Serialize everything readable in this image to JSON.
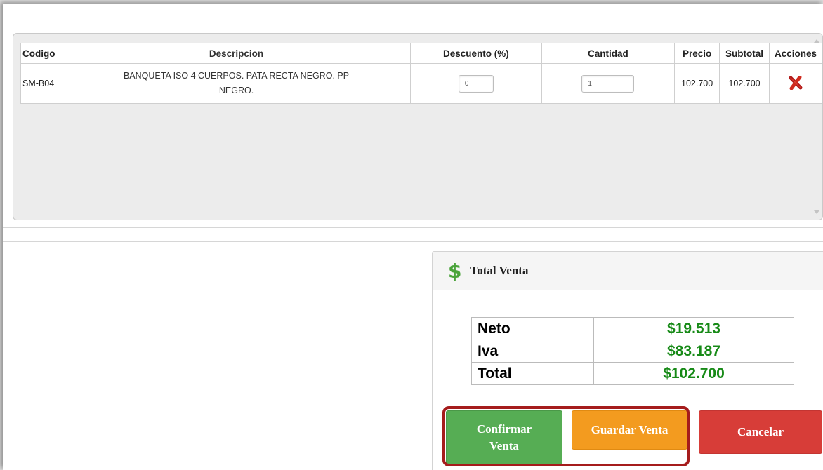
{
  "items_table": {
    "headers": [
      "Codigo",
      "Descripcion",
      "Descuento (%)",
      "Cantidad",
      "Precio",
      "Subtotal",
      "Acciones"
    ],
    "rows": [
      {
        "codigo": "SM-B04",
        "descripcion_line1": "BANQUETA ISO 4 CUERPOS. PATA RECTA NEGRO. PP",
        "descripcion_line2": "NEGRO.",
        "descuento": "0",
        "cantidad": "1",
        "precio": "102.700",
        "subtotal": "102.700",
        "accion_icon": "delete-x-icon"
      }
    ]
  },
  "total_venta": {
    "icon": "dollar-icon",
    "title": "Total Venta",
    "neto_label": "Neto",
    "neto_value": "$19.513",
    "iva_label": "Iva",
    "iva_value": "$83.187",
    "total_label": "Total",
    "total_value": "$102.700"
  },
  "buttons": {
    "confirm": "Confirmar Venta",
    "save": "Guardar Venta",
    "cancel": "Cancelar"
  },
  "colors": {
    "confirm": "#56ad54",
    "save": "#f39b1f",
    "cancel": "#d73d38",
    "value_green": "#178a17",
    "highlight": "#a51c1c"
  }
}
